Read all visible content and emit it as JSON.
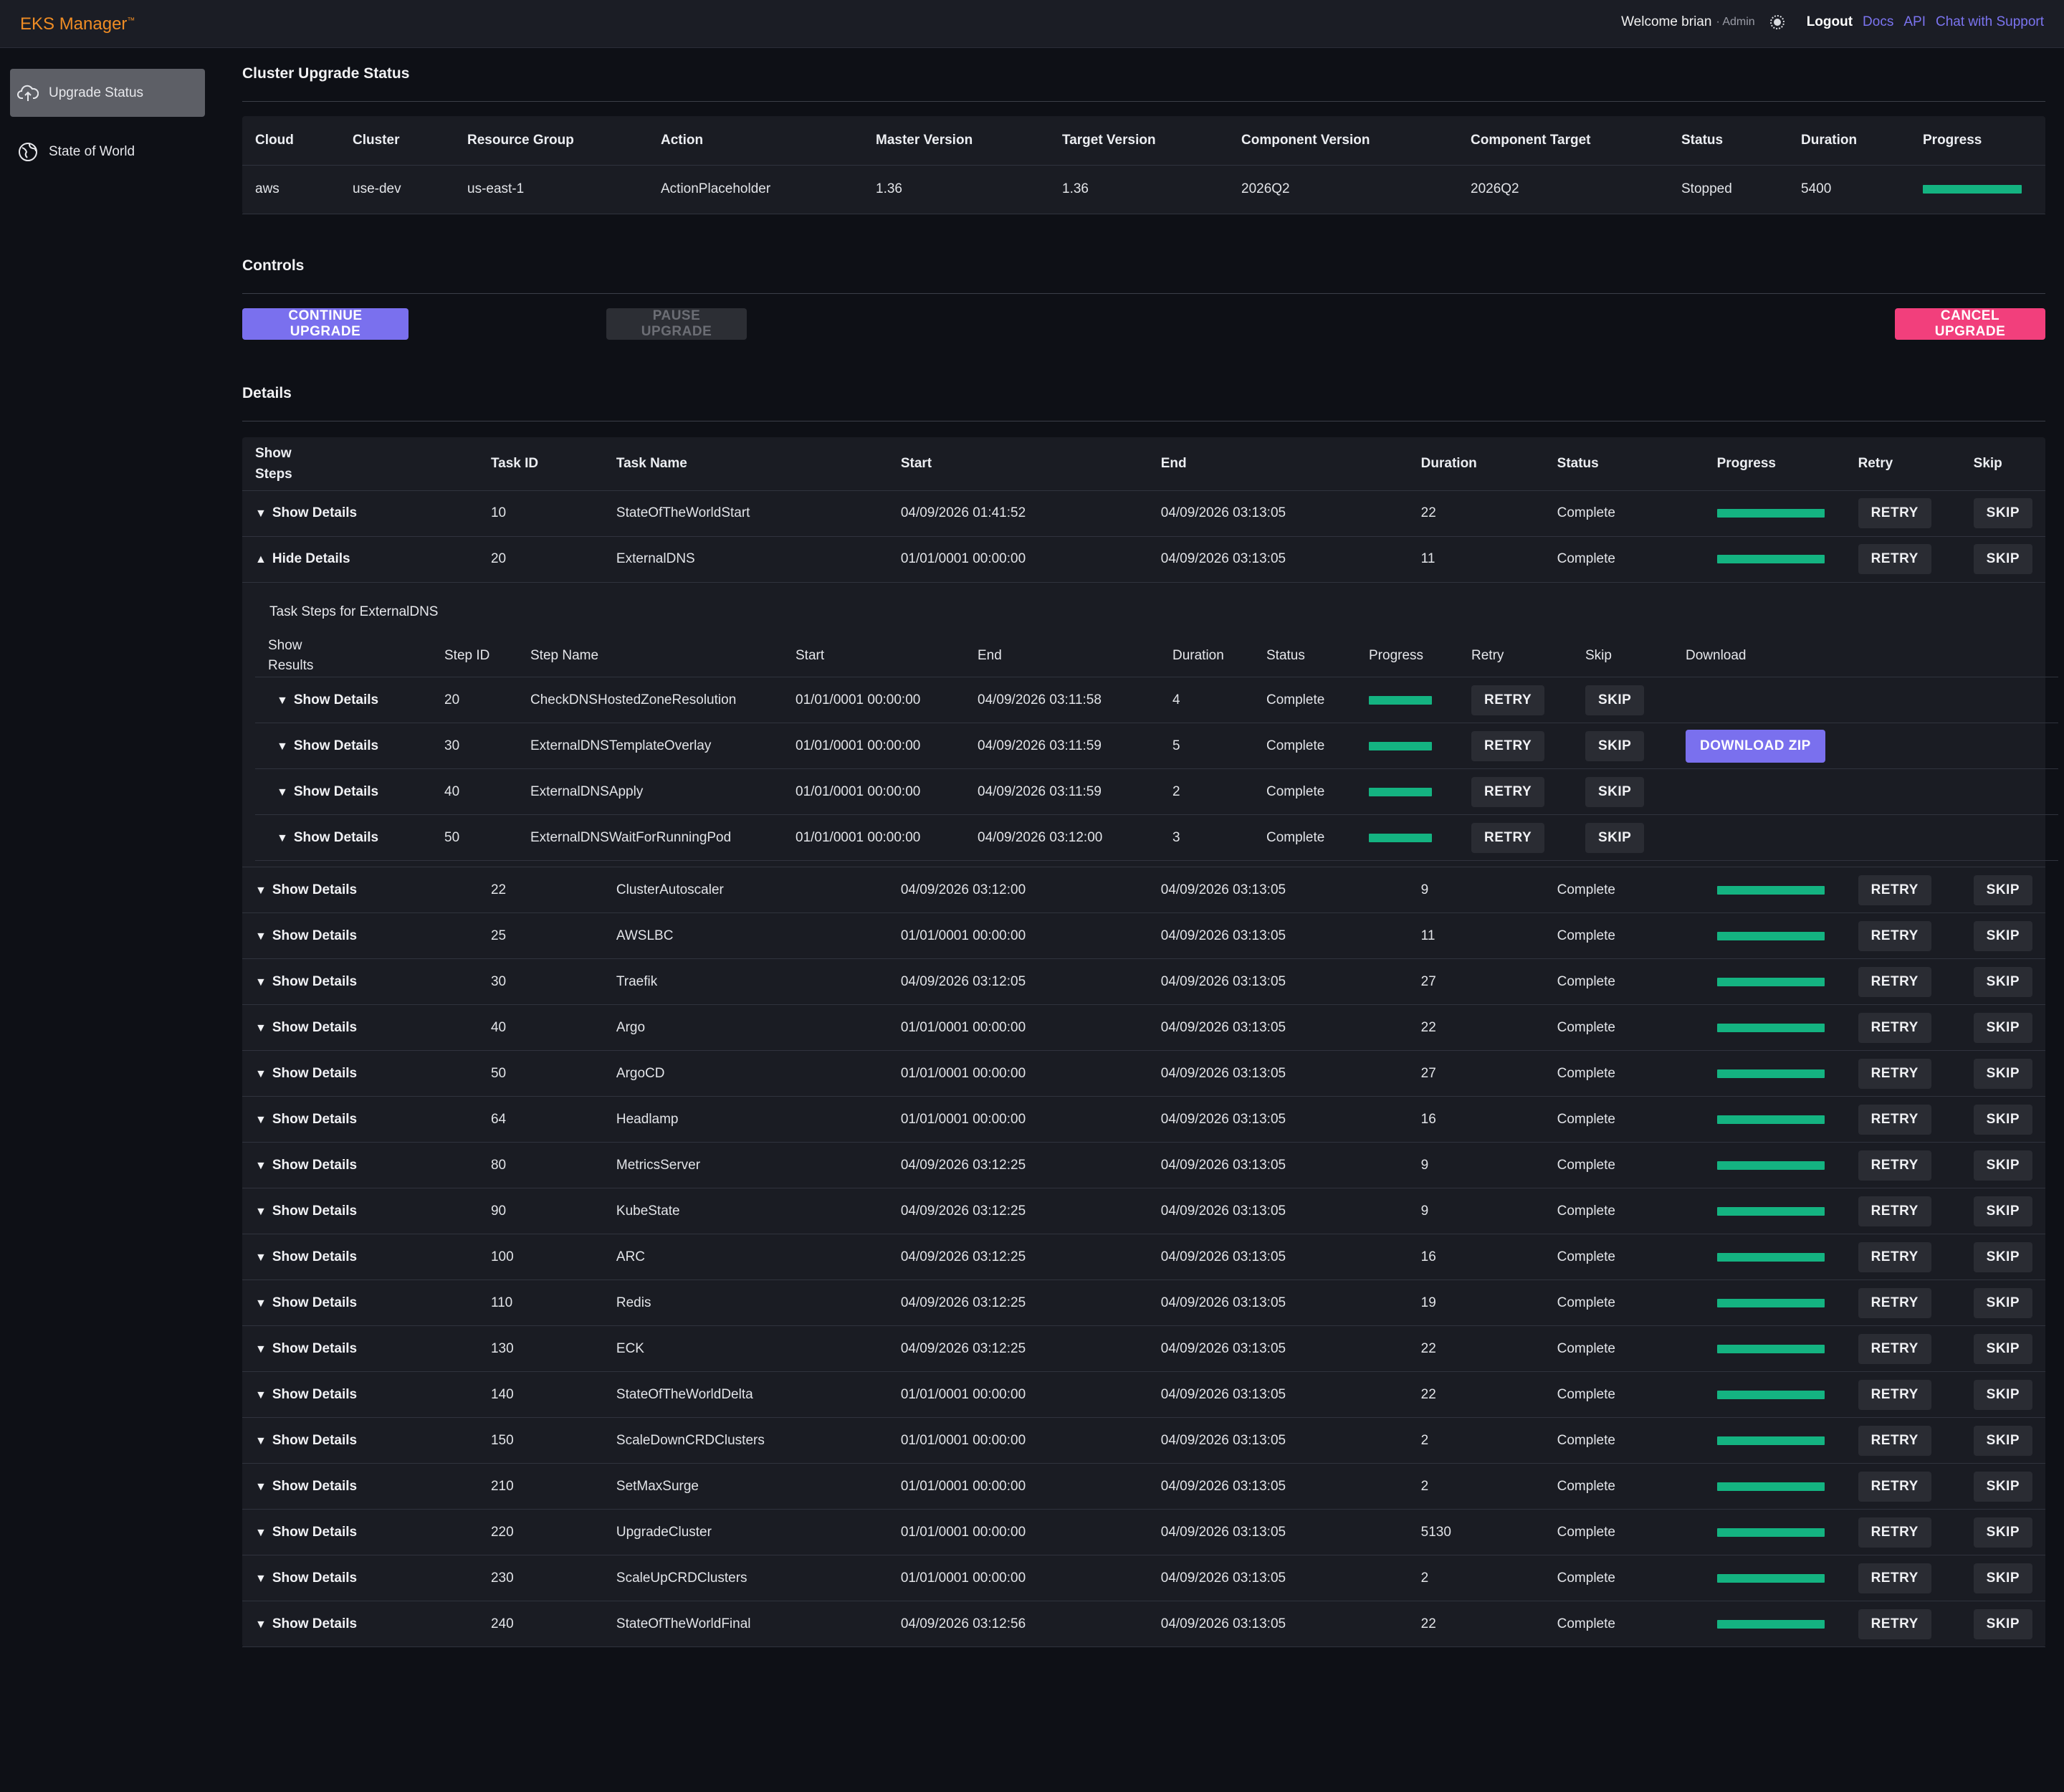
{
  "app": {
    "brand": "EKS Manager",
    "brand_mark": "™",
    "welcome": "Welcome brian",
    "role": "· Admin",
    "logout": "Logout",
    "links": [
      "Docs",
      "API",
      "Chat with Support"
    ]
  },
  "sidebar": {
    "items": [
      {
        "label": "Upgrade Status",
        "icon": "cloud-upload-icon",
        "active": true
      },
      {
        "label": "State of World",
        "icon": "globe-icon",
        "active": false
      }
    ]
  },
  "status": {
    "title": "Cluster Upgrade Status",
    "headers": [
      "Cloud",
      "Cluster",
      "Resource Group",
      "Action",
      "Master Version",
      "Target Version",
      "Component Version",
      "Component Target",
      "Status",
      "Duration",
      "Progress"
    ],
    "row": {
      "cloud": "aws",
      "cluster": "use-dev",
      "resource_group": "us-east-1",
      "action": "ActionPlaceholder",
      "master_version": "1.36",
      "target_version": "1.36",
      "component_version": "2026Q2",
      "component_target": "2026Q2",
      "status": "Stopped",
      "duration": "5400",
      "progress": 100
    }
  },
  "controls": {
    "title": "Controls",
    "continue": "CONTINUE UPGRADE",
    "pause": "PAUSE UPGRADE",
    "cancel": "CANCEL UPGRADE"
  },
  "details": {
    "title": "Details",
    "headers": {
      "show_1": "Show",
      "show_2": "Steps",
      "task_id": "Task ID",
      "task_name": "Task Name",
      "start": "Start",
      "end": "End",
      "duration": "Duration",
      "status": "Status",
      "progress": "Progress",
      "retry": "Retry",
      "skip": "Skip"
    },
    "show_label": "Show Details",
    "hide_label": "Hide Details",
    "retry_label": "RETRY",
    "skip_label": "SKIP",
    "tasks_before": [
      {
        "id": "10",
        "name": "StateOfTheWorldStart",
        "start": "04/09/2026 01:41:52",
        "end": "04/09/2026 03:13:05",
        "duration": "22",
        "status": "Complete",
        "progress": 100
      }
    ],
    "expanded_task": {
      "id": "20",
      "name": "ExternalDNS",
      "start": "01/01/0001 00:00:00",
      "end": "04/09/2026 03:13:05",
      "duration": "11",
      "status": "Complete",
      "progress": 100
    },
    "steps": {
      "title": "Task Steps for ExternalDNS",
      "headers": {
        "show_1": "Show",
        "show_2": "Results",
        "step_id": "Step ID",
        "step_name": "Step Name",
        "start": "Start",
        "end": "End",
        "duration": "Duration",
        "status": "Status",
        "progress": "Progress",
        "retry": "Retry",
        "skip": "Skip",
        "download": "Download"
      },
      "download_label": "DOWNLOAD ZIP",
      "rows": [
        {
          "id": "20",
          "name": "CheckDNSHostedZoneResolution",
          "start": "01/01/0001 00:00:00",
          "end": "04/09/2026 03:11:58",
          "duration": "4",
          "status": "Complete",
          "progress": 100,
          "download": false
        },
        {
          "id": "30",
          "name": "ExternalDNSTemplateOverlay",
          "start": "01/01/0001 00:00:00",
          "end": "04/09/2026 03:11:59",
          "duration": "5",
          "status": "Complete",
          "progress": 100,
          "download": true
        },
        {
          "id": "40",
          "name": "ExternalDNSApply",
          "start": "01/01/0001 00:00:00",
          "end": "04/09/2026 03:11:59",
          "duration": "2",
          "status": "Complete",
          "progress": 100,
          "download": false
        },
        {
          "id": "50",
          "name": "ExternalDNSWaitForRunningPod",
          "start": "01/01/0001 00:00:00",
          "end": "04/09/2026 03:12:00",
          "duration": "3",
          "status": "Complete",
          "progress": 100,
          "download": false
        }
      ]
    },
    "tasks_after": [
      {
        "id": "22",
        "name": "ClusterAutoscaler",
        "start": "04/09/2026 03:12:00",
        "end": "04/09/2026 03:13:05",
        "duration": "9",
        "status": "Complete",
        "progress": 100
      },
      {
        "id": "25",
        "name": "AWSLBC",
        "start": "01/01/0001 00:00:00",
        "end": "04/09/2026 03:13:05",
        "duration": "11",
        "status": "Complete",
        "progress": 100
      },
      {
        "id": "30",
        "name": "Traefik",
        "start": "04/09/2026 03:12:05",
        "end": "04/09/2026 03:13:05",
        "duration": "27",
        "status": "Complete",
        "progress": 100
      },
      {
        "id": "40",
        "name": "Argo",
        "start": "01/01/0001 00:00:00",
        "end": "04/09/2026 03:13:05",
        "duration": "22",
        "status": "Complete",
        "progress": 100
      },
      {
        "id": "50",
        "name": "ArgoCD",
        "start": "01/01/0001 00:00:00",
        "end": "04/09/2026 03:13:05",
        "duration": "27",
        "status": "Complete",
        "progress": 100
      },
      {
        "id": "64",
        "name": "Headlamp",
        "start": "01/01/0001 00:00:00",
        "end": "04/09/2026 03:13:05",
        "duration": "16",
        "status": "Complete",
        "progress": 100
      },
      {
        "id": "80",
        "name": "MetricsServer",
        "start": "04/09/2026 03:12:25",
        "end": "04/09/2026 03:13:05",
        "duration": "9",
        "status": "Complete",
        "progress": 100
      },
      {
        "id": "90",
        "name": "KubeState",
        "start": "04/09/2026 03:12:25",
        "end": "04/09/2026 03:13:05",
        "duration": "9",
        "status": "Complete",
        "progress": 100
      },
      {
        "id": "100",
        "name": "ARC",
        "start": "04/09/2026 03:12:25",
        "end": "04/09/2026 03:13:05",
        "duration": "16",
        "status": "Complete",
        "progress": 100
      },
      {
        "id": "110",
        "name": "Redis",
        "start": "04/09/2026 03:12:25",
        "end": "04/09/2026 03:13:05",
        "duration": "19",
        "status": "Complete",
        "progress": 100
      },
      {
        "id": "130",
        "name": "ECK",
        "start": "04/09/2026 03:12:25",
        "end": "04/09/2026 03:13:05",
        "duration": "22",
        "status": "Complete",
        "progress": 100
      },
      {
        "id": "140",
        "name": "StateOfTheWorldDelta",
        "start": "01/01/0001 00:00:00",
        "end": "04/09/2026 03:13:05",
        "duration": "22",
        "status": "Complete",
        "progress": 100
      },
      {
        "id": "150",
        "name": "ScaleDownCRDClusters",
        "start": "01/01/0001 00:00:00",
        "end": "04/09/2026 03:13:05",
        "duration": "2",
        "status": "Complete",
        "progress": 100
      },
      {
        "id": "210",
        "name": "SetMaxSurge",
        "start": "01/01/0001 00:00:00",
        "end": "04/09/2026 03:13:05",
        "duration": "2",
        "status": "Complete",
        "progress": 100
      },
      {
        "id": "220",
        "name": "UpgradeCluster",
        "start": "01/01/0001 00:00:00",
        "end": "04/09/2026 03:13:05",
        "duration": "5130",
        "status": "Complete",
        "progress": 100
      },
      {
        "id": "230",
        "name": "ScaleUpCRDClusters",
        "start": "01/01/0001 00:00:00",
        "end": "04/09/2026 03:13:05",
        "duration": "2",
        "status": "Complete",
        "progress": 100
      },
      {
        "id": "240",
        "name": "StateOfTheWorldFinal",
        "start": "04/09/2026 03:12:56",
        "end": "04/09/2026 03:13:05",
        "duration": "22",
        "status": "Complete",
        "progress": 100
      }
    ]
  },
  "colors": {
    "brand": "#ef8c24",
    "accent": "#7a70ee",
    "danger": "#f23f7c",
    "progress": "#14b381",
    "link": "#7b74f0"
  }
}
